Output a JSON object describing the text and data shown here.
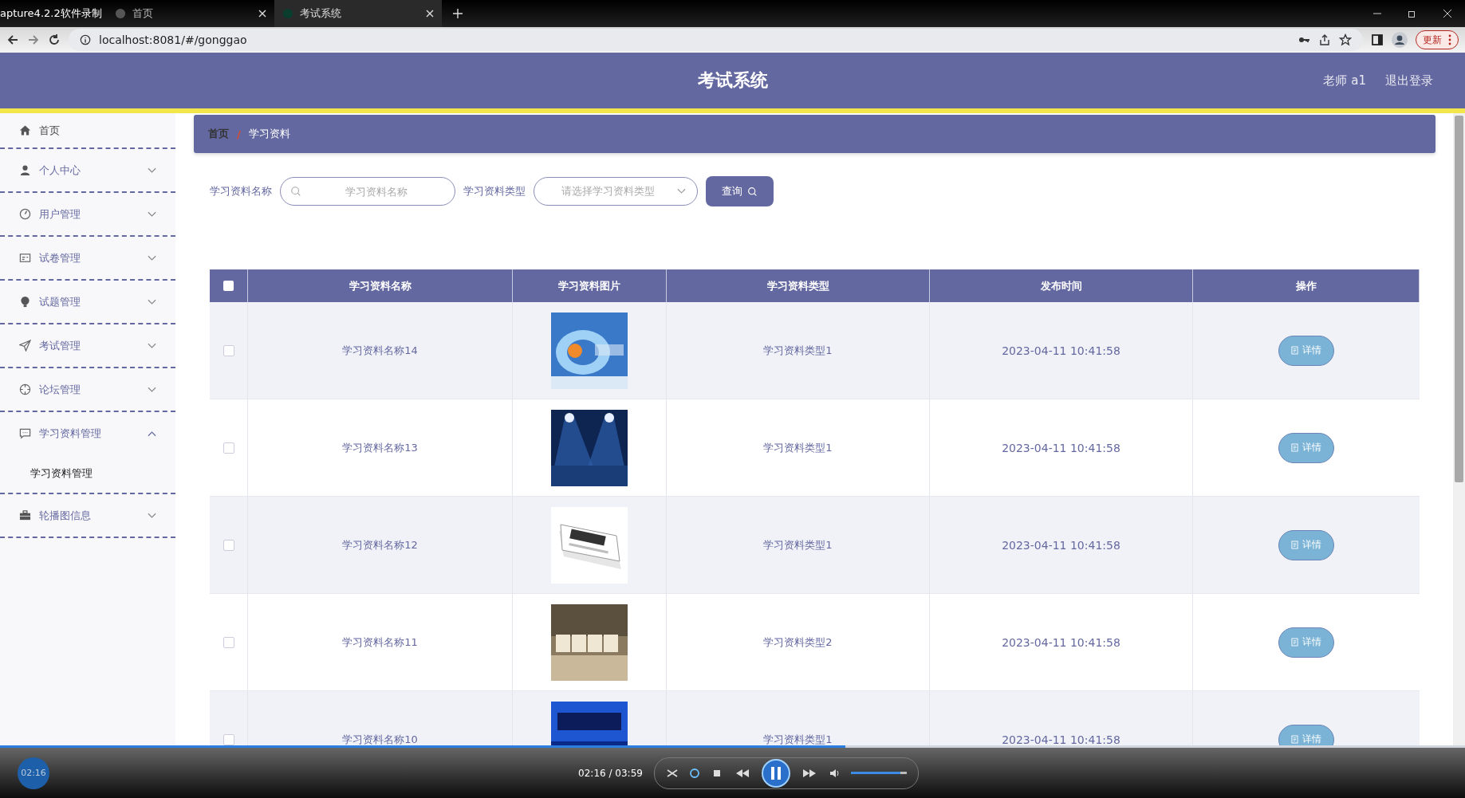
{
  "browser": {
    "tabs": [
      {
        "label": "apture4.2.2软件录制",
        "selected": false
      },
      {
        "label": "首页",
        "selected": false
      },
      {
        "label": "考试系统",
        "selected": true
      }
    ],
    "url": "localhost:8081/#/gonggao",
    "update_button": "更新"
  },
  "header": {
    "title": "考试系统",
    "user": "老师 a1",
    "logout": "退出登录"
  },
  "sidebar": {
    "items": [
      {
        "label": "首页"
      },
      {
        "label": "个人中心",
        "expanded": false
      },
      {
        "label": "用户管理",
        "expanded": false
      },
      {
        "label": "试卷管理",
        "expanded": false
      },
      {
        "label": "试题管理",
        "expanded": false
      },
      {
        "label": "考试管理",
        "expanded": false
      },
      {
        "label": "论坛管理",
        "expanded": false
      },
      {
        "label": "学习资料管理",
        "expanded": true,
        "children": [
          {
            "label": "学习资料管理"
          }
        ]
      },
      {
        "label": "轮播图信息",
        "expanded": false
      }
    ]
  },
  "breadcrumb": {
    "separator": "/",
    "items": [
      "首页",
      "学习资料"
    ]
  },
  "filters": {
    "name_label": "学习资料名称",
    "name_placeholder": "学习资料名称",
    "type_label": "学习资料类型",
    "type_placeholder": "请选择学习资料类型",
    "search_button": "查询"
  },
  "table": {
    "header_checked": false,
    "columns": [
      "学习资料名称",
      "学习资料图片",
      "学习资料类型",
      "发布时间",
      "操作"
    ],
    "rows": [
      {
        "checked": false,
        "name": "学习资料名称14",
        "type": "学习资料类型1",
        "time": "2023-04-11 10:41:58",
        "action": "详情"
      },
      {
        "checked": false,
        "name": "学习资料名称13",
        "type": "学习资料类型1",
        "time": "2023-04-11 10:41:58",
        "action": "详情"
      },
      {
        "checked": false,
        "name": "学习资料名称12",
        "type": "学习资料类型1",
        "time": "2023-04-11 10:41:58",
        "action": "详情"
      },
      {
        "checked": false,
        "name": "学习资料名称11",
        "type": "学习资料类型2",
        "time": "2023-04-11 10:41:58",
        "action": "详情"
      },
      {
        "checked": false,
        "name": "学习资料名称10",
        "type": "学习资料类型1",
        "time": "2023-04-11 10:41:58",
        "action": "详情"
      }
    ]
  },
  "player": {
    "elapsed": "02:16",
    "time": "02:16 / 03:59",
    "progress": {
      "level": 0.577
    },
    "volume": {
      "level": 0.88
    }
  }
}
